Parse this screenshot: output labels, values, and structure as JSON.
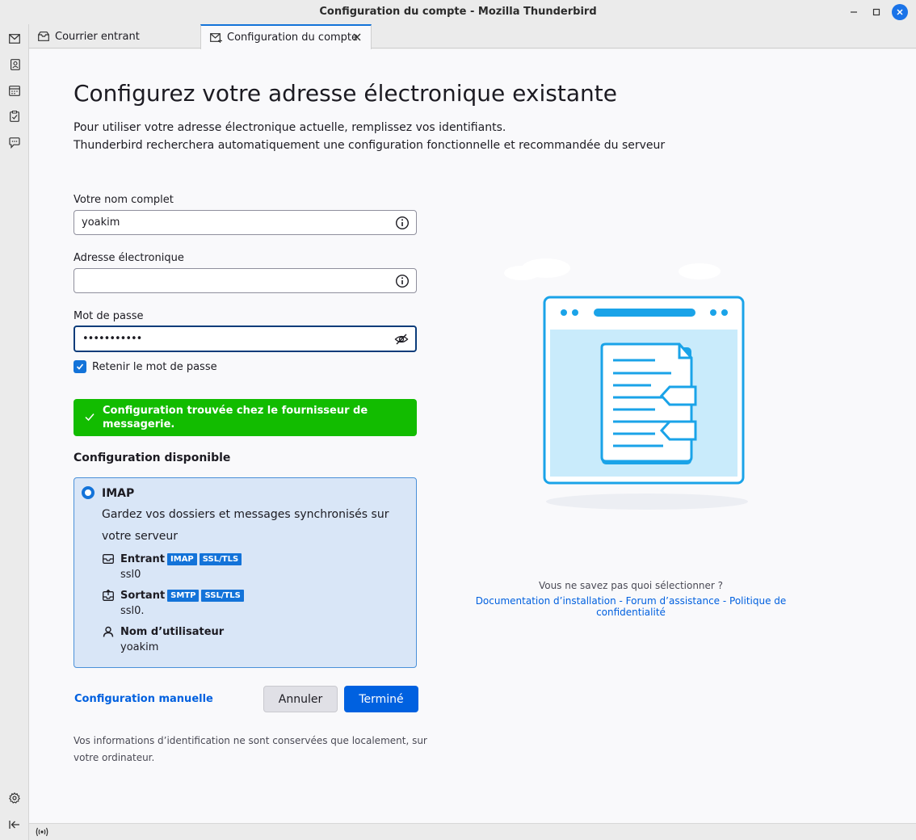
{
  "window": {
    "title": "Configuration du compte - Mozilla Thunderbird"
  },
  "tabs": [
    {
      "label": "Courrier entrant",
      "icon": "inbox-icon"
    },
    {
      "label": "Configuration du compte",
      "icon": "mail-setup-icon",
      "active": true
    }
  ],
  "page": {
    "title": "Configurez votre adresse électronique existante",
    "subtitle_line1": "Pour utiliser votre adresse électronique actuelle, remplissez vos identifiants.",
    "subtitle_line2": "Thunderbird recherchera automatiquement une configuration fonctionnelle et recommandée du serveur"
  },
  "form": {
    "name_label": "Votre nom complet",
    "name_value": "yoakim",
    "email_label": "Adresse électronique",
    "email_value": "",
    "password_label": "Mot de passe",
    "password_value": "•••••••••••",
    "remember_label": "Retenir le mot de passe",
    "remember_checked": true
  },
  "notice": {
    "text": "Configuration trouvée chez le fournisseur de messagerie."
  },
  "available": {
    "title": "Configuration disponible",
    "protocol": "IMAP",
    "description": "Gardez vos dossiers et messages synchronisés sur votre serveur",
    "incoming_label": "Entrant",
    "incoming_badges": [
      "IMAP",
      "SSL/TLS"
    ],
    "incoming_value": "ssl0",
    "outgoing_label": "Sortant",
    "outgoing_badges": [
      "SMTP",
      "SSL/TLS"
    ],
    "outgoing_value": "ssl0.",
    "username_label": "Nom d’utilisateur",
    "username_value": "yoakim"
  },
  "actions": {
    "manual": "Configuration manuelle",
    "cancel": "Annuler",
    "done": "Terminé"
  },
  "footer": {
    "privacy": "Vos informations d’identification ne sont conservées que localement, sur votre ordinateur."
  },
  "help": {
    "question": "Vous ne savez pas quoi sélectionner ?",
    "link_docs": "Documentation d’installation",
    "link_forum": "Forum d’assistance",
    "link_privacy": "Politique de confidentialité",
    "separator": " - "
  },
  "colors": {
    "accent": "#1373d9",
    "success": "#12bc00",
    "card_bg": "#d9e6f7"
  }
}
